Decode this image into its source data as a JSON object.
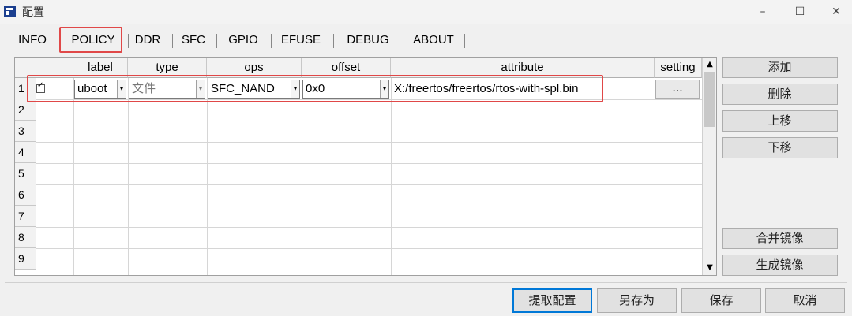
{
  "window": {
    "title": "配置",
    "controls": {
      "minimize": "–",
      "maximize": "☐",
      "close": "✕"
    }
  },
  "tabs": [
    "INFO",
    "POLICY",
    "DDR",
    "SFC",
    "GPIO",
    "EFUSE",
    "DEBUG",
    "ABOUT"
  ],
  "active_tab": "POLICY",
  "table": {
    "columns": [
      "label",
      "type",
      "ops",
      "offset",
      "attribute",
      "setting"
    ],
    "row_numbers": [
      "1",
      "2",
      "3",
      "4",
      "5",
      "6",
      "7",
      "8",
      "9"
    ],
    "row1": {
      "checked": true,
      "label": "uboot",
      "type": "文件",
      "ops": "SFC_NAND",
      "offset": "0x0",
      "attribute": "X:/freertos/freertos/rtos-with-spl.bin",
      "setting": "..."
    }
  },
  "side_buttons": {
    "add": "添加",
    "delete": "删除",
    "up": "上移",
    "down": "下移",
    "merge": "合并镜像",
    "generate": "生成镜像"
  },
  "bottom_buttons": {
    "load": "提取配置",
    "save_as": "另存为",
    "save": "保存",
    "cancel": "取消"
  },
  "highlight_color": "#e04848"
}
